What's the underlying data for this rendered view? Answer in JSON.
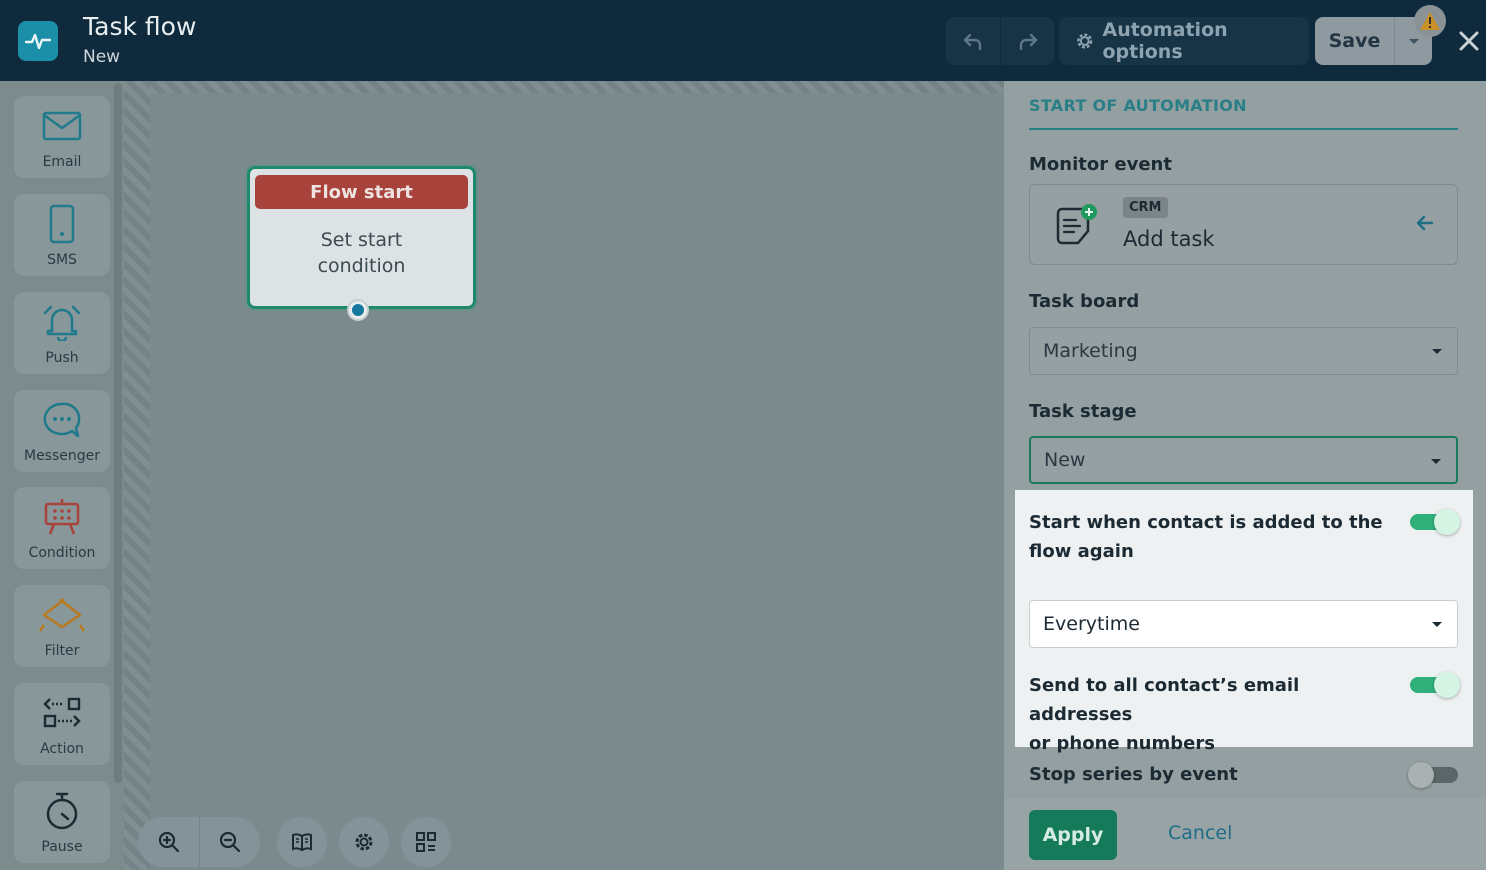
{
  "header": {
    "title": "Task flow",
    "subtitle": "New",
    "automation_options_label": "Automation options",
    "save_label": "Save"
  },
  "palette": [
    {
      "label": "Email",
      "icon": "envelope-icon",
      "color": "#1f7a8c"
    },
    {
      "label": "SMS",
      "icon": "phone-icon",
      "color": "#1f7a8c"
    },
    {
      "label": "Push",
      "icon": "bell-icon",
      "color": "#1f7a8c"
    },
    {
      "label": "Messenger",
      "icon": "chat-bubble-icon",
      "color": "#1f7a8c"
    },
    {
      "label": "Condition",
      "icon": "condition-icon",
      "color": "#a8433c"
    },
    {
      "label": "Filter",
      "icon": "filter-icon",
      "color": "#b87a1f"
    },
    {
      "label": "Action",
      "icon": "action-icon",
      "color": "#1c2a33"
    },
    {
      "label": "Pause",
      "icon": "stopwatch-icon",
      "color": "#1c2a33"
    }
  ],
  "canvas": {
    "node": {
      "header": "Flow start",
      "body_line1": "Set start",
      "body_line2": "condition"
    }
  },
  "panel": {
    "section_title": "START OF AUTOMATION",
    "monitor_event_label": "Monitor event",
    "event_badge": "CRM",
    "event_name": "Add task",
    "task_board_label": "Task board",
    "task_board_value": "Marketing",
    "task_stage_label": "Task stage",
    "task_stage_value": "New",
    "restart_label_line1": "Start when contact is added to the",
    "restart_label_line2": "flow again",
    "restart_enabled": true,
    "frequency_value": "Everytime",
    "send_all_line1": "Send to all contact’s email addresses",
    "send_all_line2": "or phone numbers",
    "send_all_enabled": true,
    "stop_series_label": "Stop series by event",
    "stop_series_enabled": false,
    "apply_label": "Apply",
    "cancel_label": "Cancel"
  },
  "colors": {
    "header_bg": "#0f2a3c",
    "accent_green": "#157a5a",
    "accent_teal": "#2a7f86",
    "node_header": "#a8433c"
  }
}
